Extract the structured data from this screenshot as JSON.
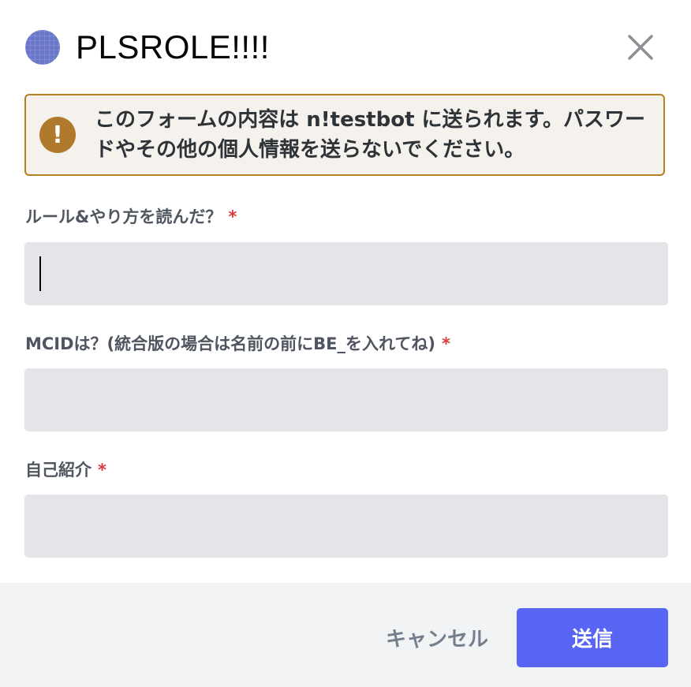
{
  "modal": {
    "title": "PLSROLE!!!!",
    "server_icon_color": "#6b78c9",
    "close_icon": "close-icon"
  },
  "warning": {
    "icon": "!",
    "text": "このフォームの内容は n!testbot に送られます。パスワードやその他の個人情報を送らないでください。",
    "border_color": "#b5801e",
    "background": "#f5f1ec"
  },
  "fields": [
    {
      "label": "ルール&やり方を読んだ？",
      "required_mark": "*",
      "value": ""
    },
    {
      "label": "MCIDは？(統合版の場合は名前の前にBE_を入れてね)",
      "required_mark": "*",
      "value": ""
    },
    {
      "label": "自己紹介",
      "required_mark": "*",
      "value": ""
    }
  ],
  "footer": {
    "cancel_label": "キャンセル",
    "submit_label": "送信",
    "submit_color": "#5865f2"
  }
}
